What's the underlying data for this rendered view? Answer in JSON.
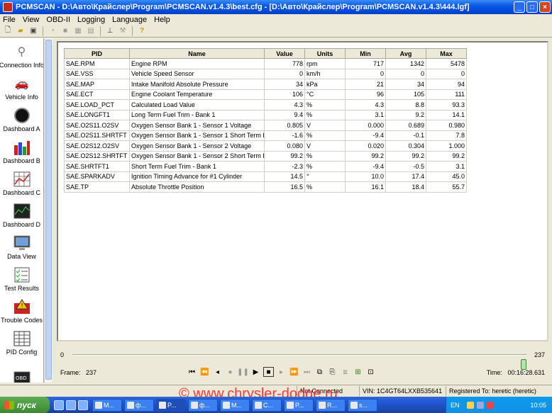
{
  "window": {
    "title": "PCMSCAN - D:\\Авто\\Крайслер\\Program\\PCMSCAN.v1.4.3\\best.cfg - [D:\\Авто\\Крайслер\\Program\\PCMSCAN.v1.4.3\\444.lgf]"
  },
  "menu": [
    "File",
    "View",
    "OBD-II",
    "Logging",
    "Language",
    "Help"
  ],
  "toolbar_icons": [
    "new-icon",
    "open-icon",
    "save-icon",
    "gauge-icon",
    "stop-icon",
    "grid-icon",
    "table-icon",
    "chart-icon",
    "car-icon",
    "help-icon"
  ],
  "sidebar": {
    "items": [
      {
        "label": "Connection Info",
        "icon": "plug-icon"
      },
      {
        "label": "Vehicle Info",
        "icon": "car-icon"
      },
      {
        "label": "Dashboard A",
        "icon": "gauge-icon"
      },
      {
        "label": "Dashboard B",
        "icon": "bar-chart-icon"
      },
      {
        "label": "Dashboard C",
        "icon": "grid-chart-icon"
      },
      {
        "label": "Dashboard D",
        "icon": "line-chart-icon"
      },
      {
        "label": "Data View",
        "icon": "monitor-icon"
      },
      {
        "label": "Test Results",
        "icon": "checklist-icon"
      },
      {
        "label": "Trouble Codes",
        "icon": "warning-icon"
      },
      {
        "label": "PID Config",
        "icon": "config-icon"
      },
      {
        "label": "",
        "icon": "obd-icon"
      }
    ]
  },
  "table": {
    "headers": [
      "PID",
      "Name",
      "Value",
      "Units",
      "Min",
      "Avg",
      "Max"
    ],
    "rows": [
      [
        "SAE.RPM",
        "Engine RPM",
        "778",
        "rpm",
        "717",
        "1342",
        "5478"
      ],
      [
        "SAE.VSS",
        "Vehicle Speed Sensor",
        "0",
        "km/h",
        "0",
        "0",
        "0"
      ],
      [
        "SAE.MAP",
        "Intake Manifold Absolute Pressure",
        "34",
        "kPa",
        "21",
        "34",
        "94"
      ],
      [
        "SAE.ECT",
        "Engine Coolant Temperature",
        "106",
        "°C",
        "96",
        "105",
        "111"
      ],
      [
        "SAE.LOAD_PCT",
        "Calculated Load Value",
        "4.3",
        "%",
        "4.3",
        "8.8",
        "93.3"
      ],
      [
        "SAE.LONGFT1",
        "Long Term Fuel Trim - Bank 1",
        "9.4",
        "%",
        "3.1",
        "9.2",
        "14.1"
      ],
      [
        "SAE.O2S11.O2SV",
        "Oxygen Sensor Bank 1 - Sensor 1 Voltage",
        "0.805",
        "V",
        "0.000",
        "0.689",
        "0.980"
      ],
      [
        "SAE.O2S11.SHRTFT",
        "Oxygen Sensor Bank 1 - Sensor 1 Short Term Fuel T",
        "-1.6",
        "%",
        "-9.4",
        "-0.1",
        "7.8"
      ],
      [
        "SAE.O2S12.O2SV",
        "Oxygen Sensor Bank 1 - Sensor 2 Voltage",
        "0.080",
        "V",
        "0.020",
        "0.304",
        "1.000"
      ],
      [
        "SAE.O2S12.SHRTFT",
        "Oxygen Sensor Bank 1 - Sensor 2 Short Term Fuel T",
        "99.2",
        "%",
        "99.2",
        "99.2",
        "99.2"
      ],
      [
        "SAE.SHRTFT1",
        "Short Term Fuel Trim - Bank 1",
        "-2.3",
        "%",
        "-9.4",
        "-0.5",
        "3.1"
      ],
      [
        "SAE.SPARKADV",
        "Ignition Timing Advance for #1 Cylinder",
        "14.5",
        "°",
        "10.0",
        "17.4",
        "45.0"
      ],
      [
        "SAE.TP",
        "Absolute Throttle Position",
        "16.5",
        "%",
        "16.1",
        "18.4",
        "55.7"
      ]
    ]
  },
  "playback": {
    "slider_min": "0",
    "slider_max": "237",
    "position_fraction": 1.0,
    "frame_label": "Frame:",
    "frame_value": "237",
    "time_label": "Time:",
    "time_value": "00:16:28.631"
  },
  "status": {
    "connection": "Not Connected",
    "vin": "VIN: 1C4GT64LXXB535641",
    "registered": "Registered To: heretic (heretic)"
  },
  "watermark": "© www.chrysler-dodge.ru",
  "taskbar": {
    "start_label": "пуск",
    "buttons": [
      "M...",
      "ф...",
      "P...",
      "ф...",
      "M...",
      "C...",
      "P...",
      "R...",
      "s..."
    ],
    "active_index": 2,
    "language": "EN",
    "clock": "10:05"
  },
  "colors": {
    "titlebar": "#0a5ae6",
    "close_button": "#d8421c",
    "watermark": "#ff1a1a",
    "taskbar": "#245edb",
    "start_button": "#3c8a2e"
  }
}
